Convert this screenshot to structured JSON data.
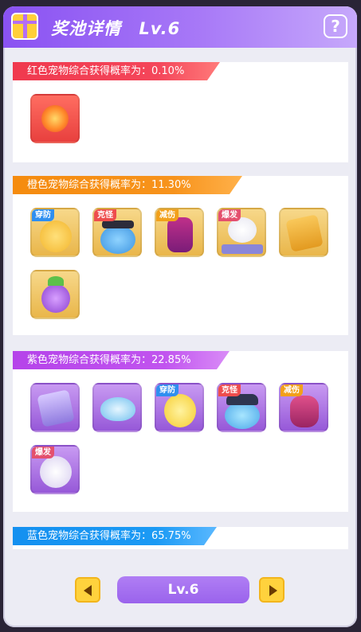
{
  "header": {
    "title": "奖池详情",
    "level": "Lv.6",
    "help_symbol": "?",
    "icon": "gift-icon"
  },
  "colors": {
    "red": "#f0394e",
    "orange": "#f58b0e",
    "purple": "#b543ea",
    "blue": "#1490f0",
    "header": "#8a52f2"
  },
  "sections": [
    {
      "label": "红色宠物综合获得概率为：0.10%",
      "items": [
        {
          "icon": "fire-egg-icon",
          "badge": ""
        }
      ]
    },
    {
      "label": "橙色宠物综合获得概率为：11.30%",
      "items": [
        {
          "icon": "chick-warrior-icon",
          "badge": "穿防"
        },
        {
          "icon": "pirate-slime-icon",
          "badge": "克怪"
        },
        {
          "icon": "ninja-icon",
          "badge": "减伤"
        },
        {
          "icon": "dj-cat-icon",
          "badge": "爆发"
        },
        {
          "icon": "paw-book-icon",
          "badge": ""
        },
        {
          "icon": "berry-icon",
          "badge": ""
        }
      ]
    },
    {
      "label": "紫色宠物综合获得概率为：22.85%",
      "items": [
        {
          "icon": "paw-book-icon",
          "badge": ""
        },
        {
          "icon": "ingot-icon",
          "badge": ""
        },
        {
          "icon": "chick-icon",
          "badge": "穿防"
        },
        {
          "icon": "police-slime-icon",
          "badge": "克怪"
        },
        {
          "icon": "ant-icon",
          "badge": "减伤"
        },
        {
          "icon": "cat-icon",
          "badge": "爆发"
        }
      ]
    },
    {
      "label": "蓝色宠物综合获得概率为：65.75%",
      "items": []
    }
  ],
  "footer": {
    "level_label": "Lv.6",
    "prev": "left-arrow-icon",
    "next": "right-arrow-icon"
  }
}
